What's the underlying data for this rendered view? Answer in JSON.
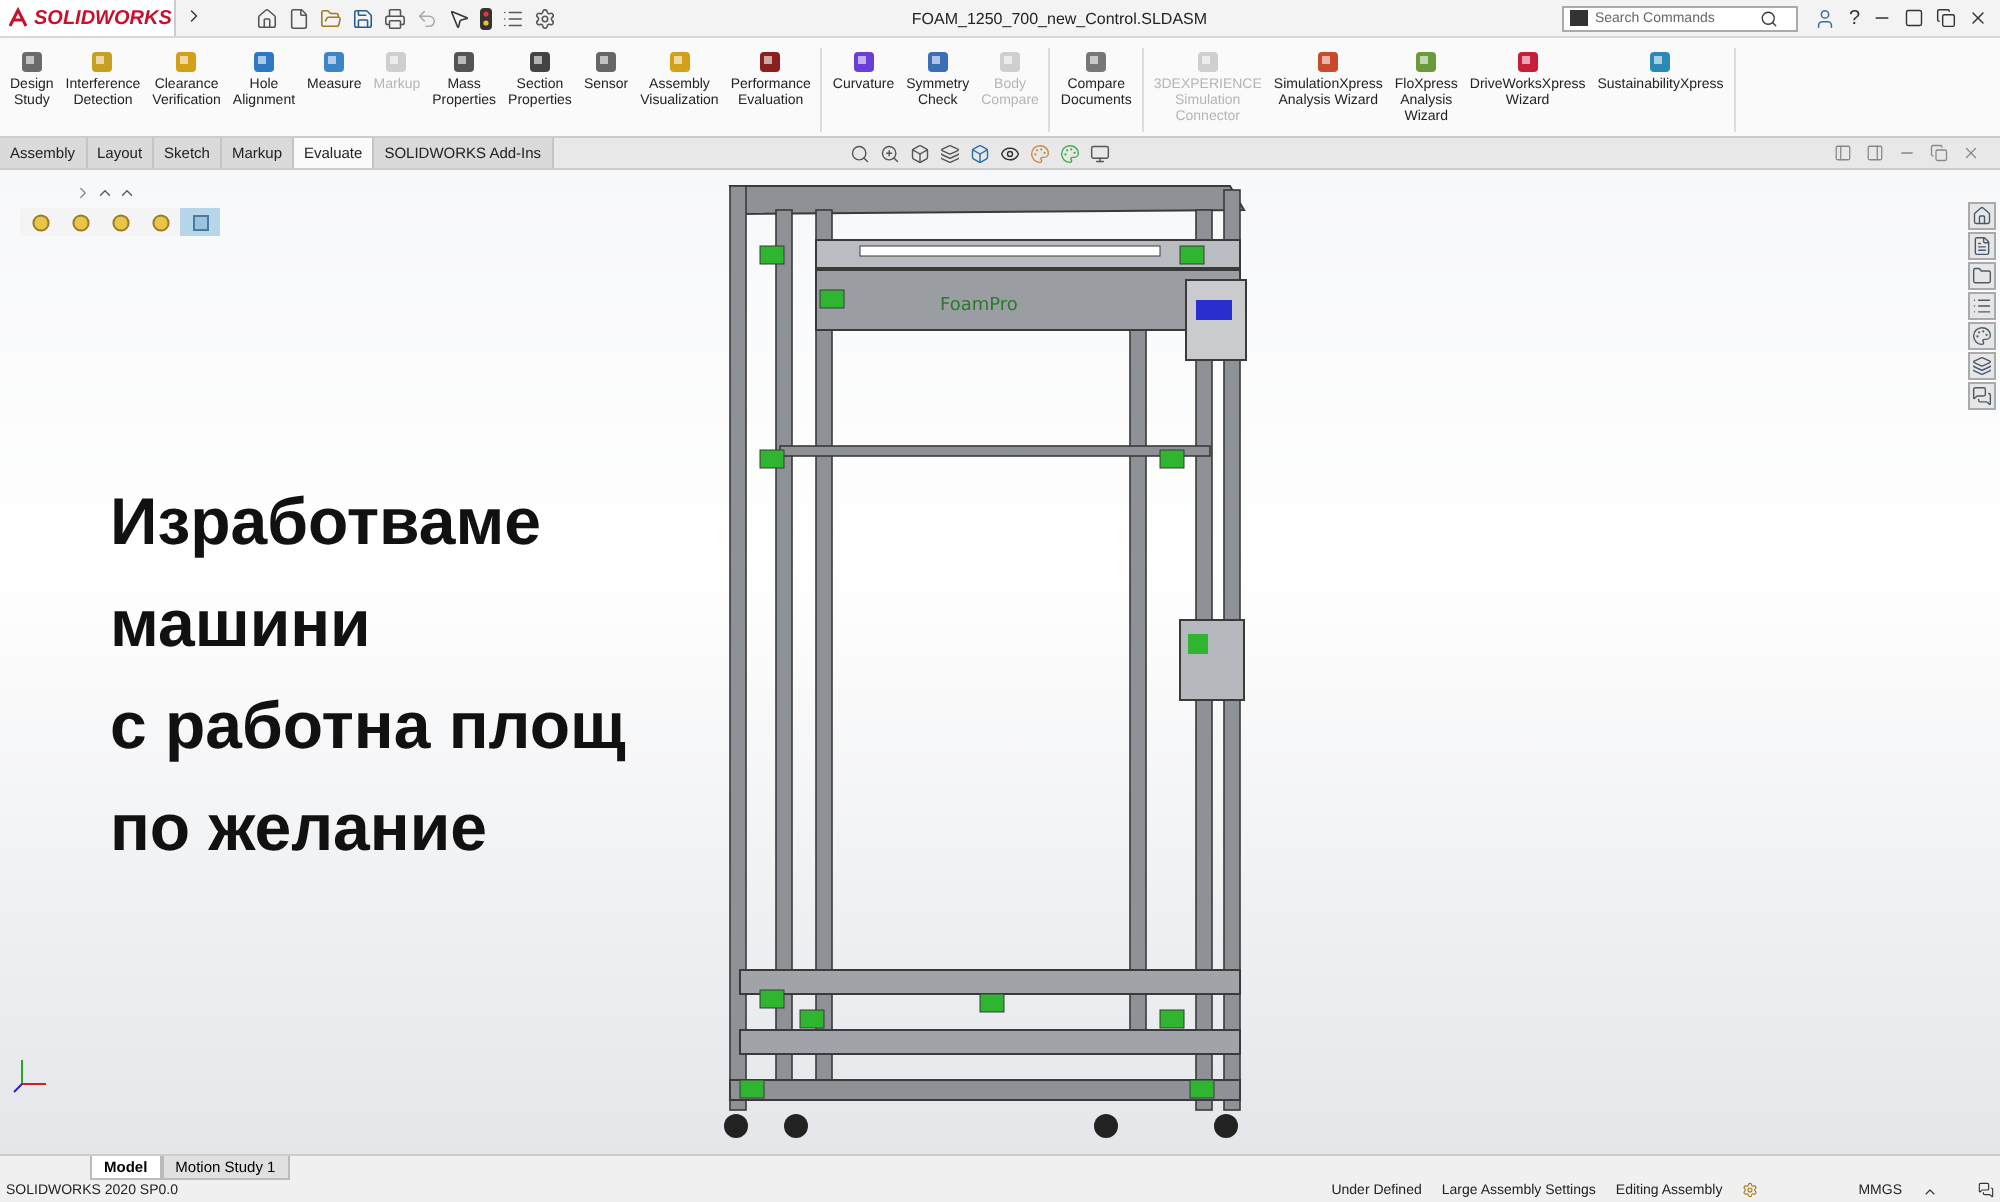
{
  "window": {
    "logo": "SOLIDWORKS",
    "title": "FOAM_1250_700_new_Control.SLDASM",
    "help": "?"
  },
  "search": {
    "placeholder": "Search Commands"
  },
  "ribbon": {
    "groups": [
      [
        {
          "lines": [
            "Design",
            "Study"
          ],
          "disabled": false
        },
        {
          "lines": [
            "Interference",
            "Detection"
          ],
          "disabled": false
        },
        {
          "lines": [
            "Clearance",
            "Verification"
          ],
          "disabled": false
        },
        {
          "lines": [
            "Hole",
            "Alignment"
          ],
          "disabled": false
        },
        {
          "lines": [
            "Measure"
          ],
          "disabled": false
        },
        {
          "lines": [
            "Markup"
          ],
          "disabled": true
        },
        {
          "lines": [
            "Mass",
            "Properties"
          ],
          "disabled": false
        },
        {
          "lines": [
            "Section",
            "Properties"
          ],
          "disabled": false
        },
        {
          "lines": [
            "Sensor"
          ],
          "disabled": false
        },
        {
          "lines": [
            "Assembly",
            "Visualization"
          ],
          "disabled": false
        },
        {
          "lines": [
            "Performance",
            "Evaluation"
          ],
          "disabled": false
        }
      ],
      [
        {
          "lines": [
            "Curvature"
          ],
          "disabled": false
        },
        {
          "lines": [
            "Symmetry",
            "Check"
          ],
          "disabled": false
        },
        {
          "lines": [
            "Body",
            "Compare"
          ],
          "disabled": true
        }
      ],
      [
        {
          "lines": [
            "Compare",
            "Documents"
          ],
          "disabled": false
        }
      ],
      [
        {
          "lines": [
            "3DEXPERIENCE",
            "Simulation",
            "Connector"
          ],
          "disabled": true
        },
        {
          "lines": [
            "SimulationXpress",
            "Analysis Wizard"
          ],
          "disabled": false
        },
        {
          "lines": [
            "FloXpress",
            "Analysis",
            "Wizard"
          ],
          "disabled": false
        },
        {
          "lines": [
            "DriveWorksXpress",
            "Wizard"
          ],
          "disabled": false
        },
        {
          "lines": [
            "SustainabilityXpress"
          ],
          "disabled": false
        }
      ]
    ]
  },
  "tabs": [
    {
      "label": "Assembly",
      "selected": false
    },
    {
      "label": "Layout",
      "selected": false
    },
    {
      "label": "Sketch",
      "selected": false
    },
    {
      "label": "Markup",
      "selected": false
    },
    {
      "label": "Evaluate",
      "selected": true
    },
    {
      "label": "SOLIDWORKS Add-Ins",
      "selected": false
    }
  ],
  "breadcrumb": [
    {
      "selected": false
    },
    {
      "selected": false
    },
    {
      "selected": false
    },
    {
      "selected": false
    },
    {
      "selected": true
    }
  ],
  "headline": [
    "Изработваме",
    "машини",
    "с работна площ",
    "по желание"
  ],
  "model_label": "FoamPro",
  "bottom_tabs": [
    {
      "label": "Model",
      "selected": true
    },
    {
      "label": "Motion Study 1",
      "selected": false
    }
  ],
  "status_bar": {
    "version": "SOLIDWORKS 2020 SP0.0",
    "items": [
      "Under Defined",
      "Large Assembly Settings",
      "Editing Assembly"
    ],
    "units": "MMGS"
  }
}
